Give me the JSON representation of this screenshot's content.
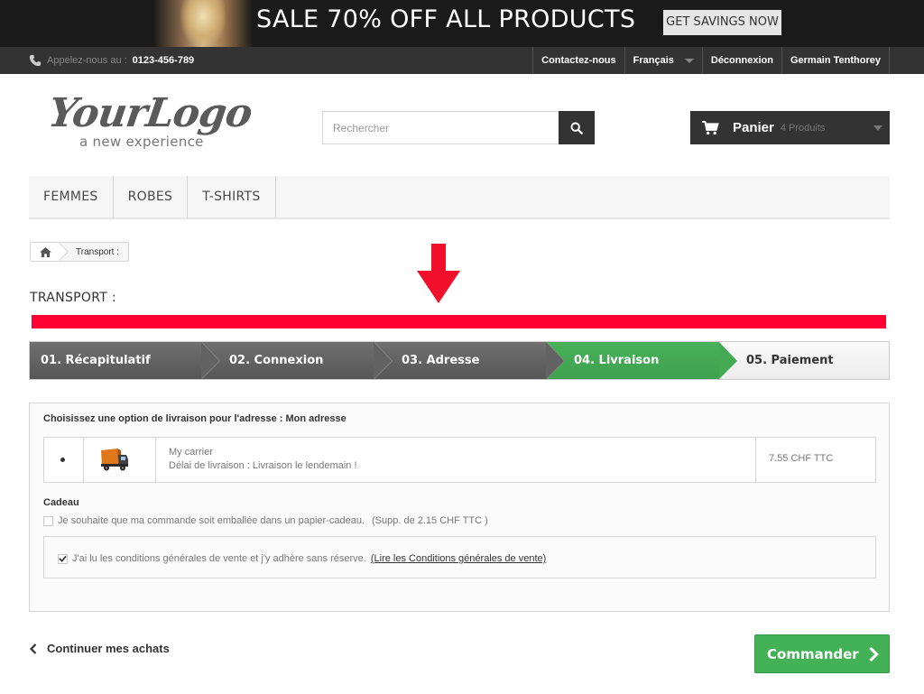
{
  "promo": {
    "text": "SALE 70% OFF ALL PRODUCTS",
    "button": "GET SAVINGS NOW"
  },
  "topnav": {
    "phone_label": "Appelez-nous au :",
    "phone_number": "0123-456-789",
    "contact": "Contactez-nous",
    "language": "Français",
    "logout": "Déconnexion",
    "user": "Germain Tenthorey"
  },
  "header": {
    "logo_main": "YourLogo",
    "logo_sub": "a new experience",
    "search_placeholder": "Rechercher",
    "cart_label": "Panier",
    "cart_count": "4 Produits"
  },
  "menu": [
    "FEMMES",
    "ROBES",
    "T-SHIRTS"
  ],
  "breadcrumb": "Transport :",
  "page_title": "TRANSPORT :",
  "steps": [
    "01. Récapitulatif",
    "02. Connexion",
    "03. Adresse",
    "04. Livraison",
    "05. Paiement"
  ],
  "active_step": 4,
  "delivery": {
    "title": "Choisissez une option de livraison pour l'adresse : Mon adresse",
    "carrier_name": "My carrier",
    "carrier_delay": "Délai de livraison : Livraison le lendemain !",
    "carrier_price": "7.55 CHF TTC",
    "gift_heading": "Cadeau",
    "gift_label": "Je souhaite que ma commande soit emballée dans un papier-cadeau.",
    "gift_extra": "(Supp. de 2.15 CHF TTC )",
    "gift_checked": false,
    "terms_label": "J'ai lu les conditions générales de vente et j'y adhère sans réserve.",
    "terms_link": "(Lire les Conditions générales de vente)",
    "terms_checked": true
  },
  "actions": {
    "continue": "Continuer mes achats",
    "order": "Commander"
  },
  "colors": {
    "accent_green": "#43b155",
    "highlight_red": "#ff0033",
    "dark": "#333333"
  }
}
